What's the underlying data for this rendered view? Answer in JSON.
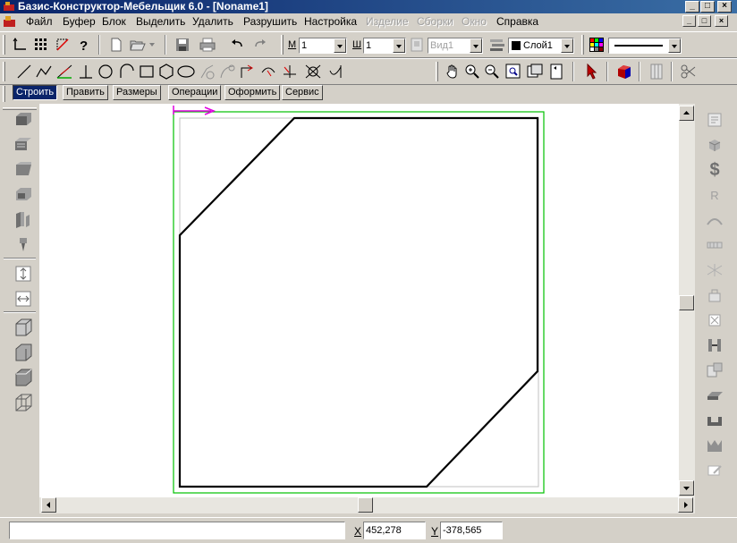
{
  "window": {
    "title": "Базис-Конструктор-Мебельщик 6.0 - [Noname1]",
    "minimize": "_",
    "maximize": "□",
    "close": "×"
  },
  "menu": {
    "items": [
      {
        "label": "Файл",
        "enabled": true
      },
      {
        "label": "Буфер",
        "enabled": true
      },
      {
        "label": "Блок",
        "enabled": true
      },
      {
        "label": "Выделить",
        "enabled": true
      },
      {
        "label": "Удалить",
        "enabled": true
      },
      {
        "label": "Разрушить",
        "enabled": true
      },
      {
        "label": "Настройка",
        "enabled": true
      },
      {
        "label": "Изделие",
        "enabled": false
      },
      {
        "label": "Сборки",
        "enabled": false
      },
      {
        "label": "Окно",
        "enabled": false
      },
      {
        "label": "Справка",
        "enabled": true
      }
    ],
    "mdi_minimize": "_",
    "mdi_restore": "□",
    "mdi_close": "×"
  },
  "toolbar": {
    "m_label": "М",
    "m_value": "1",
    "w_label": "Ш",
    "w_value": "1",
    "view_value": "Вид1",
    "layer_value": "Слой1",
    "layer_color": "#000000"
  },
  "tabs": [
    {
      "label": "Строить",
      "active": true
    },
    {
      "label": "Править",
      "active": false
    },
    {
      "label": "Размеры",
      "active": false
    },
    {
      "label": "Операции",
      "active": false
    },
    {
      "label": "Оформить",
      "active": false
    },
    {
      "label": "Сервис",
      "active": false
    }
  ],
  "status": {
    "message": "",
    "x_label": "X",
    "x_value": "452,278",
    "y_label": "Y",
    "y_value": "-378,565"
  },
  "colors": {
    "title_bar": "#0a246a",
    "active_tab": "#0a246a",
    "sheet_border": "#00c000",
    "axis_marker": "#e000e0",
    "drawing_line": "#000000"
  },
  "icons": {
    "right_panel_dollar": "$",
    "right_panel_r": "R"
  }
}
